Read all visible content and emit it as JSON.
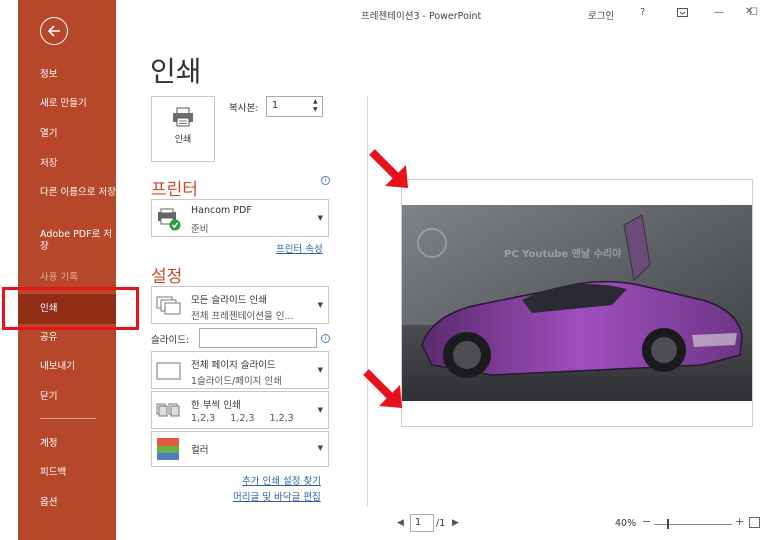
{
  "window": {
    "title": "프레젠테이션3  -  PowerPoint",
    "signin": "로그인",
    "help": "?",
    "minimize": "—",
    "maximize": "☐",
    "close": "✕"
  },
  "sidebar": {
    "items": [
      {
        "label": "정보"
      },
      {
        "label": "새로 만들기"
      },
      {
        "label": "열기"
      },
      {
        "label": "저장"
      },
      {
        "label": "다른 이름으로 저장"
      },
      {
        "label": "Adobe PDF로 저장"
      },
      {
        "label": "사용 기록"
      },
      {
        "label": "인쇄"
      },
      {
        "label": "공유"
      },
      {
        "label": "내보내기"
      },
      {
        "label": "닫기"
      },
      {
        "label": "계정"
      },
      {
        "label": "피드백"
      },
      {
        "label": "옵션"
      }
    ],
    "active": "인쇄",
    "colors": {
      "background": "#b7472a",
      "active": "#922e16",
      "highlight_box": "#e8121a"
    }
  },
  "main": {
    "heading": "인쇄",
    "print_button": {
      "label": "인쇄"
    },
    "copies": {
      "label": "복사본:",
      "value": "1"
    },
    "printer": {
      "heading": "프린터",
      "name": "Hancom PDF",
      "status": "준비",
      "properties_link": "프린터 속성"
    },
    "settings": {
      "heading": "설정",
      "range": {
        "main": "모든 슬라이드 인쇄",
        "sub": "전체 프레젠테이션을 인..."
      },
      "slides_label": "슬라이드:",
      "slides_value": "",
      "layout": {
        "main": "전체 페이지 슬라이드",
        "sub": "1슬라이드/페이지 인쇄"
      },
      "collate": {
        "main": "한 부씩 인쇄",
        "sub": "1,2,3     1,2,3     1,2,3"
      },
      "color": {
        "main": "컬러"
      },
      "more_link": "추가 인쇄 설정 찾기",
      "header_footer_link": "머리글 및 바닥글 편집"
    },
    "accent_color": "#d24726",
    "link_color": "#2e5ea8"
  },
  "preview": {
    "watermark": "PC  Youtube  맨날 수리야",
    "current_page": "1",
    "total_pages": "/1",
    "zoom": "40%"
  }
}
